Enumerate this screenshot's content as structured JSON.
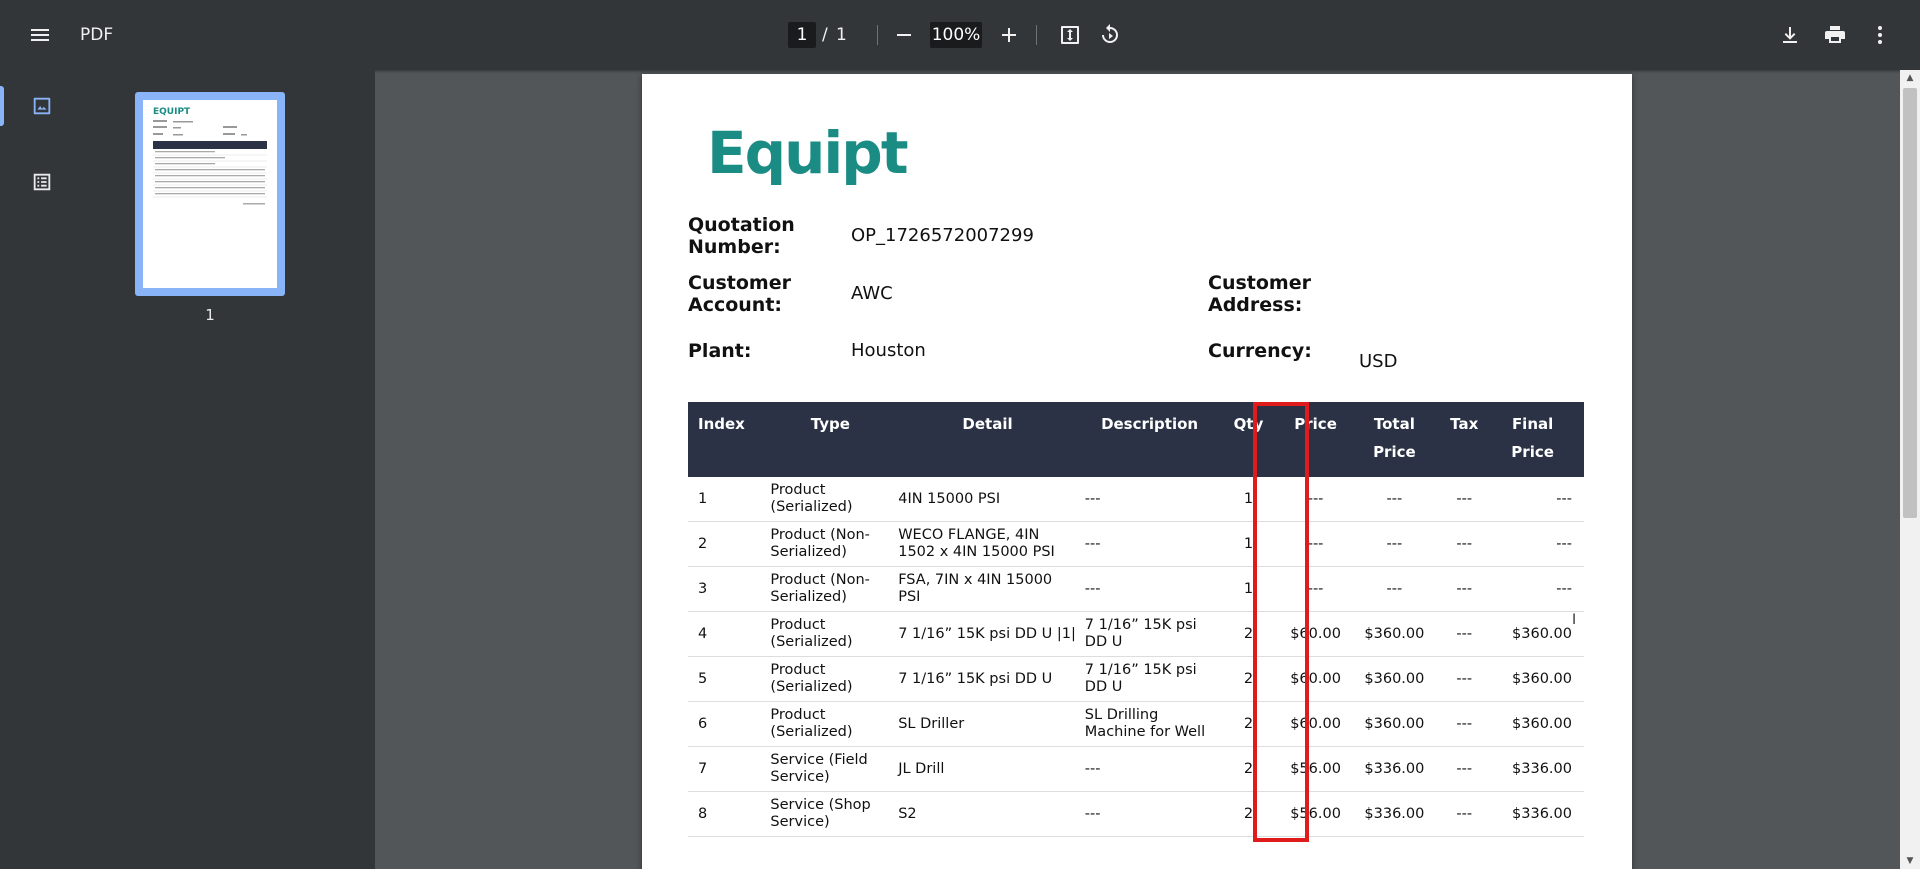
{
  "toolbar": {
    "title": "PDF",
    "current_page": "1",
    "page_separator": "/",
    "total_pages": "1",
    "zoom": "100%"
  },
  "sidebar": {
    "thumbnail_page_number": "1"
  },
  "document": {
    "logo_text": "Equipt",
    "fields": {
      "quotation_number_label": "Quotation Number:",
      "quotation_number": "OP_1726572007299",
      "customer_account_label": "Customer Account:",
      "customer_account": "AWC",
      "customer_address_label": "Customer Address:",
      "customer_address": "",
      "plant_label": "Plant:",
      "plant": "Houston",
      "currency_label": "Currency:",
      "currency": "USD"
    },
    "table": {
      "headers": [
        "Index",
        "Type",
        "Detail",
        "Description",
        "Qty",
        "Price",
        "Total Price",
        "Tax",
        "Final Price"
      ],
      "rows": [
        [
          "1",
          "Product (Serialized)",
          "4IN 15000 PSI",
          "---",
          "1",
          "---",
          "---",
          "---",
          "---"
        ],
        [
          "2",
          "Product (Non-Serialized)",
          "WECO FLANGE, 4IN 1502 x 4IN 15000 PSI",
          "---",
          "1",
          "---",
          "---",
          "---",
          "---"
        ],
        [
          "3",
          "Product (Non-Serialized)",
          "FSA, 7IN x 4IN 15000 PSI",
          "---",
          "1",
          "---",
          "---",
          "---",
          "---"
        ],
        [
          "4",
          "Product (Serialized)",
          "7 1/16” 15K psi DD U |1|",
          "7 1/16” 15K psi DD U",
          "2",
          "$60.00",
          "$360.00",
          "---",
          "$360.00"
        ],
        [
          "5",
          "Product (Serialized)",
          "7 1/16” 15K psi DD U",
          "7 1/16” 15K psi DD U",
          "2",
          "$60.00",
          "$360.00",
          "---",
          "$360.00"
        ],
        [
          "6",
          "Product (Serialized)",
          "SL Driller",
          "SL Drilling Machine for Well",
          "2",
          "$60.00",
          "$360.00",
          "---",
          "$360.00"
        ],
        [
          "7",
          "Service (Field Service)",
          "JL Drill",
          "---",
          "2",
          "$56.00",
          "$336.00",
          "---",
          "$336.00"
        ],
        [
          "8",
          "Service (Shop Service)",
          "S2",
          "---",
          "2",
          "$56.00",
          "$336.00",
          "---",
          "$336.00"
        ]
      ]
    }
  },
  "colors": {
    "toolbar_bg": "#323639",
    "viewer_bg": "#525659",
    "table_header_bg": "#2b3245",
    "logo": "#1a8c84",
    "highlight": "#e01b1b",
    "accent": "#8ab4f8"
  },
  "icons": {
    "menu": "hamburger-menu-icon",
    "zoom_out": "minus-icon",
    "zoom_in": "plus-icon",
    "fit": "fit-to-page-icon",
    "rotate": "rotate-icon",
    "download": "download-icon",
    "print": "print-icon",
    "more": "more-vert-icon",
    "thumbnails": "image-icon",
    "outline": "list-icon"
  }
}
